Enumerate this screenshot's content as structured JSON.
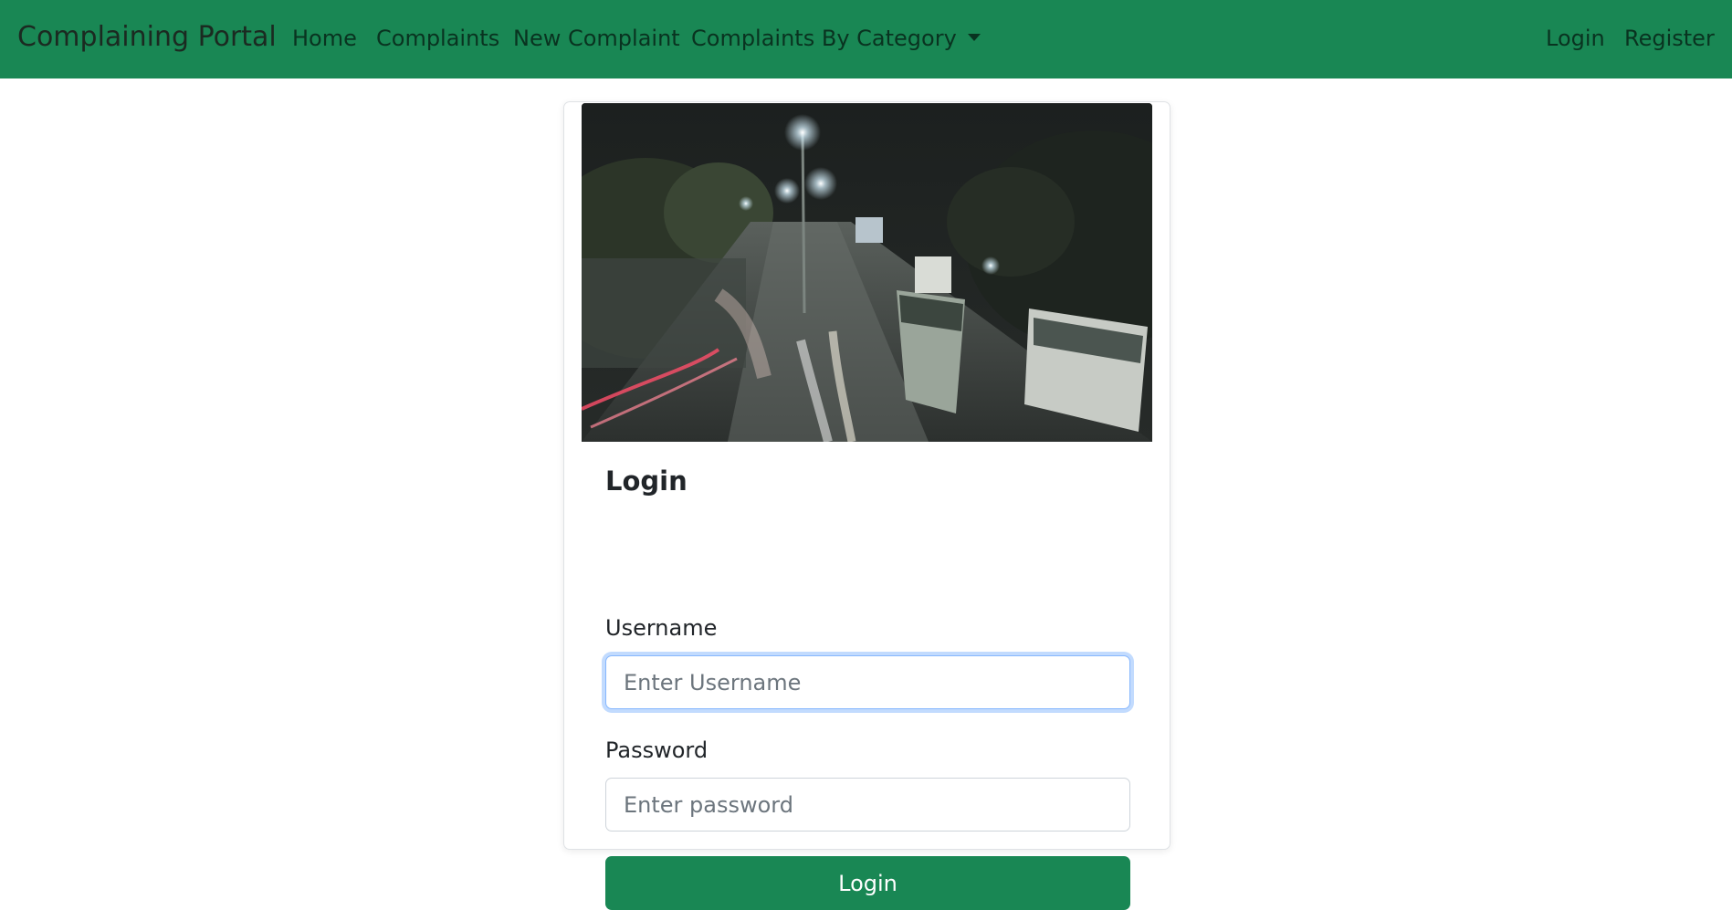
{
  "navbar": {
    "brand": "Complaining Portal",
    "links": [
      "Home",
      "Complaints",
      "New Complaint",
      "Complaints By Category"
    ],
    "right_links": [
      "Login",
      "Register"
    ],
    "background_color": "#198754"
  },
  "login_card": {
    "image": "night-street-traffic-photo",
    "title": "Login",
    "username": {
      "label": "Username",
      "placeholder": "Enter Username",
      "value": ""
    },
    "password": {
      "label": "Password",
      "placeholder": "Enter password",
      "value": ""
    },
    "submit_label": "Login",
    "button_color": "#198754"
  }
}
